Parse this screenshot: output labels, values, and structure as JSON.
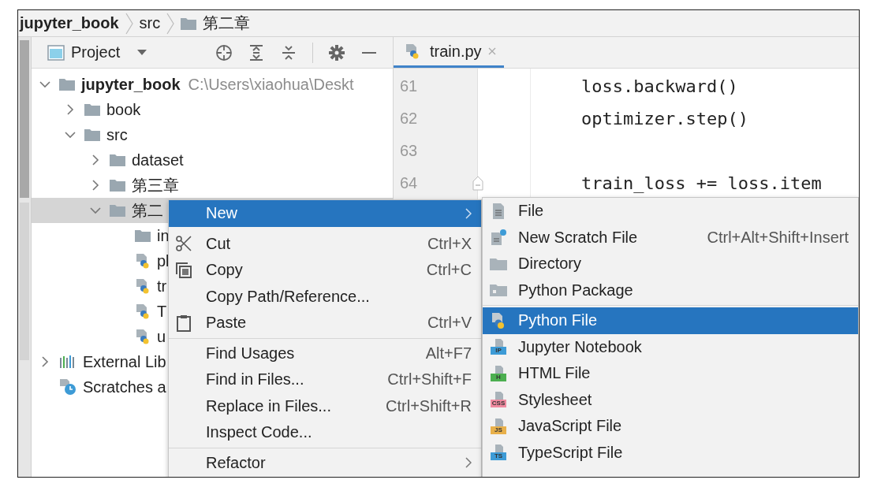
{
  "breadcrumb": [
    {
      "label": "jupyter_book",
      "kind": "project"
    },
    {
      "label": "src",
      "kind": "dir"
    },
    {
      "label": "第二章",
      "kind": "folder"
    }
  ],
  "tool_strip": [
    {
      "selected": true
    },
    {
      "selected": false
    }
  ],
  "project_panel": {
    "title": "Project",
    "tree": [
      {
        "label": "jupyter_book",
        "kind": "root",
        "path": "C:\\Users\\xiaohua\\Deskt",
        "expanded": true,
        "selected": false,
        "children": [
          {
            "label": "book",
            "kind": "folder",
            "expanded": false,
            "selected": false
          },
          {
            "label": "src",
            "kind": "folder",
            "expanded": true,
            "selected": false,
            "children": [
              {
                "label": "dataset",
                "kind": "folder",
                "expanded": false,
                "selected": false
              },
              {
                "label": "第三章",
                "kind": "folder",
                "expanded": false,
                "selected": false
              },
              {
                "label": "第二",
                "kind": "folder",
                "expanded": true,
                "selected": true,
                "children": [
                  {
                    "label": "in",
                    "kind": "folder",
                    "selected": false
                  },
                  {
                    "label": "pl",
                    "kind": "python",
                    "selected": false
                  },
                  {
                    "label": "tr",
                    "kind": "python",
                    "selected": false
                  },
                  {
                    "label": "T",
                    "kind": "python",
                    "selected": false
                  },
                  {
                    "label": "u",
                    "kind": "python",
                    "selected": false
                  }
                ]
              }
            ]
          }
        ]
      },
      {
        "label": "External Lib",
        "kind": "library",
        "expanded": false,
        "selected": false
      },
      {
        "label": "Scratches a",
        "kind": "scratches",
        "selected": false
      }
    ]
  },
  "editor": {
    "tabs": [
      {
        "label": "train.py",
        "selected": true
      }
    ],
    "lines": [
      {
        "number": "61",
        "code": "loss.backward()",
        "fold": false
      },
      {
        "number": "62",
        "code": "optimizer.step()",
        "fold": false
      },
      {
        "number": "63",
        "fold": false
      },
      {
        "number": "64",
        "code": "train_loss += loss.item",
        "fold": true
      }
    ]
  },
  "context_menu": [
    {
      "kind": "submenu",
      "label": "New",
      "selected": true
    },
    {
      "kind": "cut",
      "label": "Cut",
      "shortcut": "Ctrl+X",
      "selected": false
    },
    {
      "kind": "copy",
      "label": "Copy",
      "shortcut": "Ctrl+C",
      "selected": false
    },
    {
      "kind": "plain",
      "label": "Copy Path/Reference...",
      "selected": false
    },
    {
      "kind": "paste",
      "label": "Paste",
      "shortcut": "Ctrl+V",
      "selected": false
    },
    {
      "kind": "separator"
    },
    {
      "kind": "plain",
      "label": "Find Usages",
      "shortcut": "Alt+F7",
      "selected": false
    },
    {
      "kind": "plain",
      "label": "Find in Files...",
      "shortcut": "Ctrl+Shift+F",
      "selected": false
    },
    {
      "kind": "plain",
      "label": "Replace in Files...",
      "shortcut": "Ctrl+Shift+R",
      "selected": false
    },
    {
      "kind": "plain",
      "label": "Inspect Code...",
      "selected": false
    },
    {
      "kind": "separator"
    },
    {
      "kind": "submenu",
      "label": "Refactor",
      "selected": false
    }
  ],
  "submenu": [
    {
      "kind": "file",
      "label": "File",
      "selected": false
    },
    {
      "kind": "scratch",
      "label": "New Scratch File",
      "shortcut": "Ctrl+Alt+Shift+Insert",
      "selected": false
    },
    {
      "kind": "directory",
      "label": "Directory",
      "selected": false
    },
    {
      "kind": "package",
      "label": "Python Package",
      "selected": false
    },
    {
      "kind": "separator"
    },
    {
      "kind": "python",
      "label": "Python File",
      "selected": true
    },
    {
      "kind": "badged",
      "badge": "IP",
      "color": "#3d9bd6",
      "label": "Jupyter Notebook",
      "selected": false
    },
    {
      "kind": "badged",
      "badge": "H",
      "color": "#4caf50",
      "label": "HTML File",
      "selected": false
    },
    {
      "kind": "badged",
      "badge": "CSS",
      "color": "#f08aa0",
      "label": "Stylesheet",
      "selected": false
    },
    {
      "kind": "badged",
      "badge": "JS",
      "color": "#e8b04a",
      "label": "JavaScript File",
      "selected": false
    },
    {
      "kind": "badged",
      "badge": "TS",
      "color": "#3d9bd6",
      "label": "TypeScript File",
      "selected": false
    }
  ]
}
